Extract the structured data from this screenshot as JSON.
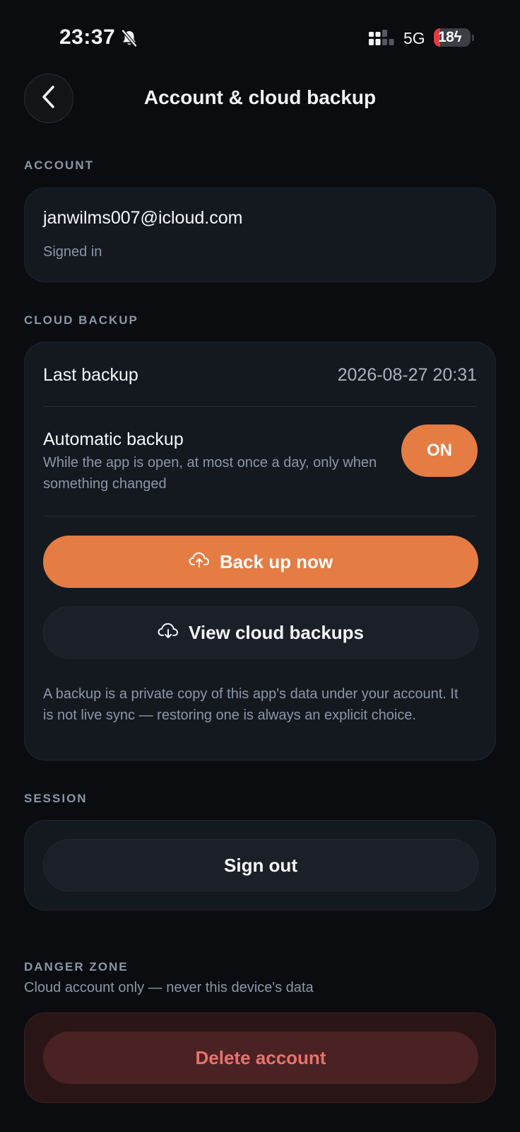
{
  "status_bar": {
    "time": "23:37",
    "network": "5G",
    "battery": "18",
    "battery_level": 0.18,
    "icons": [
      "bell-slash-icon",
      "signal-icon",
      "battery-charging-icon"
    ]
  },
  "header": {
    "title": "Account & cloud backup",
    "back_icon": "chevron-left-icon"
  },
  "account": {
    "label": "ACCOUNT",
    "email": "janwilms007@icloud.com",
    "status": "Signed in"
  },
  "cloud_backup": {
    "label": "CLOUD BACKUP",
    "last_backup_label": "Last backup",
    "last_backup_value": "2026-08-27 20:31",
    "auto_label": "Automatic backup",
    "auto_description": "While the app is open, at most once a day, only when something changed",
    "auto_toggle": "ON",
    "backup_now": "Back up now",
    "backup_now_icon": "cloud-upload-icon",
    "view_backups": "View cloud backups",
    "view_backups_icon": "cloud-download-icon",
    "note": "A backup is a private copy of this app's data under your account. It is not live sync — restoring one is always an explicit choice."
  },
  "session": {
    "label": "SESSION",
    "sign_out": "Sign out"
  },
  "danger_zone": {
    "label": "DANGER ZONE",
    "subtitle": "Cloud account only — never this device's data",
    "delete": "Delete account"
  },
  "colors": {
    "accent": "#e47c44",
    "background": "#0a0c10",
    "card": "#141920",
    "danger_text": "#e9726c",
    "danger_bg": "#2a1516"
  }
}
